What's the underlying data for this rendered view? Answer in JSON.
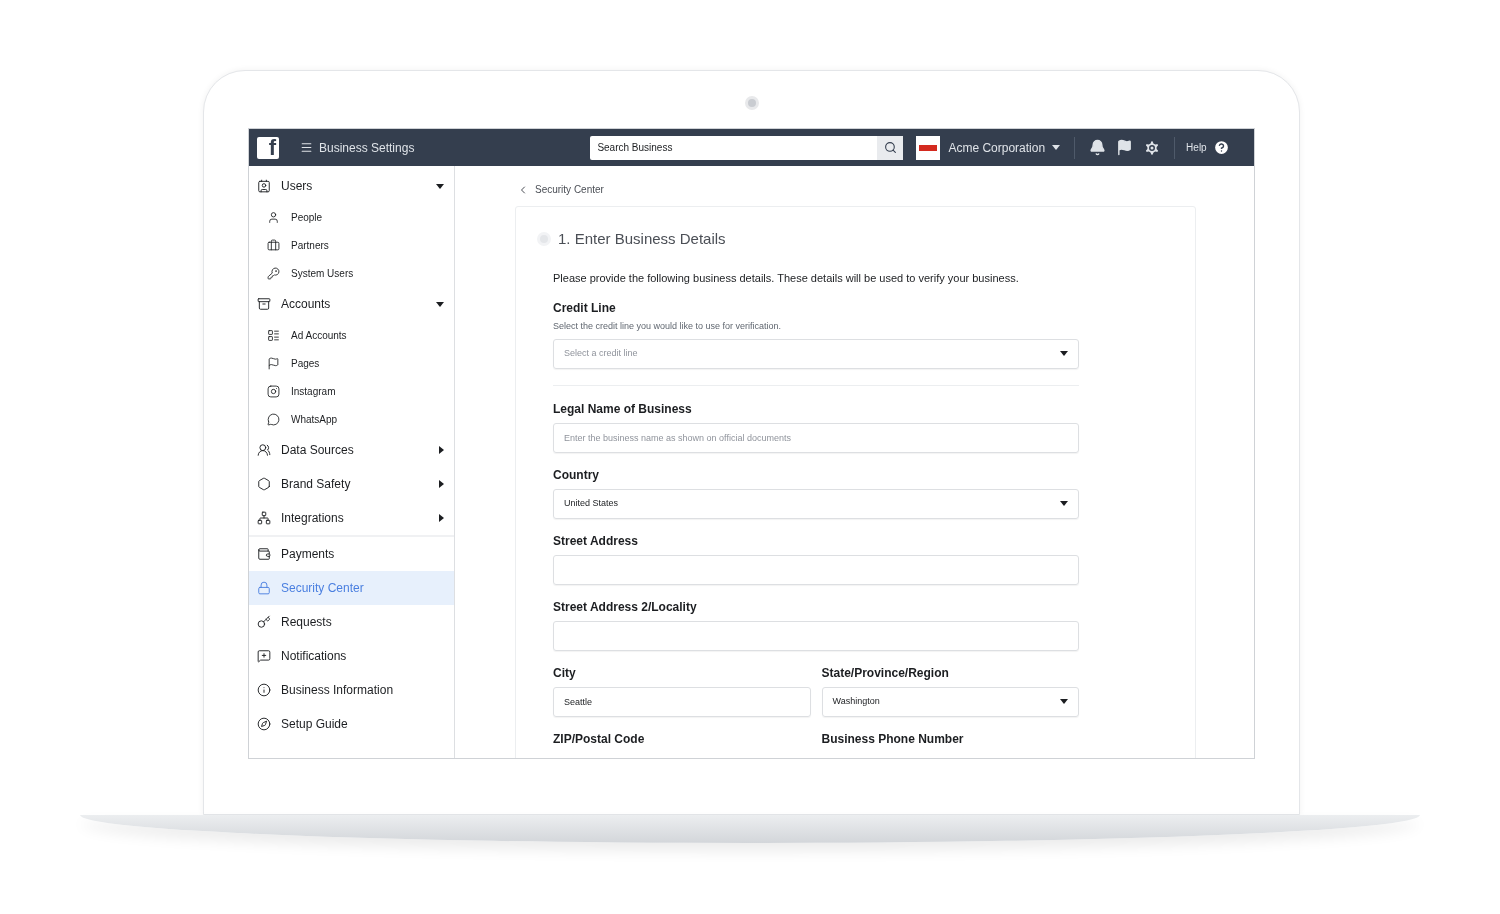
{
  "topbar": {
    "logo": "f",
    "title": "Business Settings",
    "search": {
      "placeholder": "Search Business"
    },
    "account": "Acme Corporation",
    "help": "Help"
  },
  "sidebar": {
    "groups": [
      [
        {
          "label": "Users",
          "selected": false,
          "expanded": true,
          "children": [
            {
              "label": "People",
              "selected": false
            },
            {
              "label": "Partners",
              "selected": false
            },
            {
              "label": "System Users",
              "selected": false
            }
          ]
        },
        {
          "label": "Accounts",
          "selected": false,
          "expanded": true,
          "children": [
            {
              "label": "Ad Accounts",
              "selected": false
            },
            {
              "label": "Pages",
              "selected": false
            },
            {
              "label": "Instagram",
              "selected": false
            },
            {
              "label": "WhatsApp",
              "selected": false
            }
          ]
        },
        {
          "label": "Data Sources",
          "selected": false,
          "expanded": false
        },
        {
          "label": "Brand Safety",
          "selected": false,
          "expanded": false
        },
        {
          "label": "Integrations",
          "selected": false,
          "expanded": false
        }
      ],
      [
        {
          "label": "Payments",
          "selected": false
        },
        {
          "label": "Security Center",
          "selected": true
        },
        {
          "label": "Requests",
          "selected": false
        },
        {
          "label": "Notifications",
          "selected": false
        },
        {
          "label": "Business Information",
          "selected": false
        },
        {
          "label": "Setup Guide",
          "selected": false
        }
      ]
    ]
  },
  "breadcrumb": "Security Center",
  "step": {
    "title": "1. Enter Business Details",
    "intro": "Please provide the following business details. These details will be used to verify your business.",
    "sections": [
      [
        {
          "fields": [
            {
              "label": "Credit Line",
              "hint": "Select the credit line you would like to use for verification.",
              "kind": "select",
              "placeholder": "Select a credit line"
            }
          ]
        }
      ],
      [
        {
          "fields": [
            {
              "label": "Legal Name of Business",
              "kind": "text",
              "placeholder": "Enter the business name as shown on official documents"
            }
          ]
        },
        {
          "fields": [
            {
              "label": "Country",
              "kind": "select",
              "value": "United States"
            }
          ]
        },
        {
          "fields": [
            {
              "label": "Street Address",
              "kind": "text"
            }
          ]
        },
        {
          "fields": [
            {
              "label": "Street Address 2/Locality",
              "kind": "text"
            }
          ]
        },
        {
          "fields": [
            {
              "label": "City",
              "kind": "text",
              "value": "Seattle"
            },
            {
              "label": "State/Province/Region",
              "kind": "select",
              "value": "Washington"
            }
          ]
        },
        {
          "fields": [
            {
              "label": "ZIP/Postal Code",
              "kind": "label"
            },
            {
              "label": "Business Phone Number",
              "kind": "label"
            }
          ]
        }
      ]
    ]
  }
}
